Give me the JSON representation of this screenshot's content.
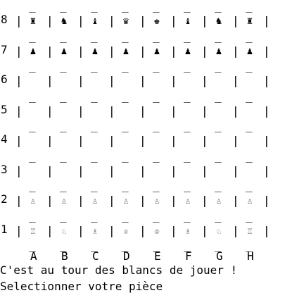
{
  "board": {
    "bar": "|",
    "dash": "_",
    "ranks": [
      "8",
      "7",
      "6",
      "5",
      "4",
      "3",
      "2",
      "1"
    ],
    "files": [
      "A",
      "B",
      "C",
      "D",
      "E",
      "F",
      "G",
      "H"
    ],
    "rows": [
      [
        {
          "glyph": "♜",
          "piece": "black-rook"
        },
        {
          "glyph": "♞",
          "piece": "black-knight"
        },
        {
          "glyph": "♝",
          "piece": "black-bishop"
        },
        {
          "glyph": "♛",
          "piece": "black-queen"
        },
        {
          "glyph": "♚",
          "piece": "black-king"
        },
        {
          "glyph": "♝",
          "piece": "black-bishop"
        },
        {
          "glyph": "♞",
          "piece": "black-knight"
        },
        {
          "glyph": "♜",
          "piece": "black-rook"
        }
      ],
      [
        {
          "glyph": "♟",
          "piece": "black-pawn"
        },
        {
          "glyph": "♟",
          "piece": "black-pawn"
        },
        {
          "glyph": "♟",
          "piece": "black-pawn"
        },
        {
          "glyph": "♟",
          "piece": "black-pawn"
        },
        {
          "glyph": "♟",
          "piece": "black-pawn"
        },
        {
          "glyph": "♟",
          "piece": "black-pawn"
        },
        {
          "glyph": "♟",
          "piece": "black-pawn"
        },
        {
          "glyph": "♟",
          "piece": "black-pawn"
        }
      ],
      [
        null,
        null,
        null,
        null,
        null,
        null,
        null,
        null
      ],
      [
        null,
        null,
        null,
        null,
        null,
        null,
        null,
        null
      ],
      [
        null,
        null,
        null,
        null,
        null,
        null,
        null,
        null
      ],
      [
        null,
        null,
        null,
        null,
        null,
        null,
        null,
        null
      ],
      [
        {
          "glyph": "♙",
          "piece": "white-pawn"
        },
        {
          "glyph": "♙",
          "piece": "white-pawn"
        },
        {
          "glyph": "♙",
          "piece": "white-pawn"
        },
        {
          "glyph": "♙",
          "piece": "white-pawn"
        },
        {
          "glyph": "♙",
          "piece": "white-pawn"
        },
        {
          "glyph": "♙",
          "piece": "white-pawn"
        },
        {
          "glyph": "♙",
          "piece": "white-pawn"
        },
        {
          "glyph": "♙",
          "piece": "white-pawn"
        }
      ],
      [
        {
          "glyph": "♖",
          "piece": "white-rook"
        },
        {
          "glyph": "♘",
          "piece": "white-knight"
        },
        {
          "glyph": "♗",
          "piece": "white-bishop"
        },
        {
          "glyph": "♕",
          "piece": "white-queen"
        },
        {
          "glyph": "♔",
          "piece": "white-king"
        },
        {
          "glyph": "♗",
          "piece": "white-bishop"
        },
        {
          "glyph": "♘",
          "piece": "white-knight"
        },
        {
          "glyph": "♖",
          "piece": "white-rook"
        }
      ]
    ]
  },
  "status": {
    "turn": "C'est au tour des blancs de jouer !",
    "prompt": "Selectionner votre pièce"
  }
}
